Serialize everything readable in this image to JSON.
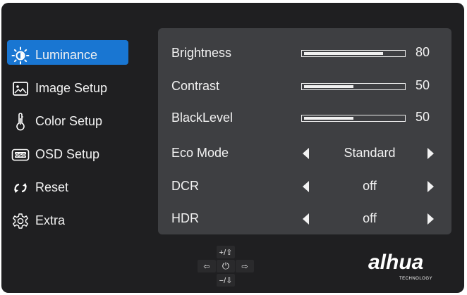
{
  "sidebar": {
    "items": [
      {
        "label": "Luminance",
        "icon": "sun-icon",
        "active": true
      },
      {
        "label": "Image Setup",
        "icon": "image-icon",
        "active": false
      },
      {
        "label": "Color Setup",
        "icon": "thermometer-icon",
        "active": false
      },
      {
        "label": "OSD Setup",
        "icon": "osd-icon",
        "active": false
      },
      {
        "label": "Reset",
        "icon": "reset-icon",
        "active": false
      },
      {
        "label": "Extra",
        "icon": "gear-icon",
        "active": false
      }
    ]
  },
  "panel": {
    "brightness": {
      "label": "Brightness",
      "value": "80",
      "level": 80
    },
    "contrast": {
      "label": "Contrast",
      "value": "50",
      "level": 50
    },
    "blacklevel": {
      "label": "BlackLevel",
      "value": "50",
      "level": 50
    },
    "eco_mode": {
      "label": "Eco Mode",
      "value": "Standard"
    },
    "dcr": {
      "label": "DCR",
      "value": "off"
    },
    "hdr": {
      "label": "HDR",
      "value": "off"
    }
  },
  "keys": {
    "up": "+/⇧",
    "down": "−/⇩",
    "left": "⇦",
    "power": "⏻",
    "right": "⇨"
  },
  "logo": {
    "word": "alhua",
    "tagline": "TECHNOLOGY"
  },
  "colors": {
    "background": "#1f1f21",
    "panel": "#3e3f42",
    "accent": "#1976d2",
    "text": "#f2f2f2"
  }
}
